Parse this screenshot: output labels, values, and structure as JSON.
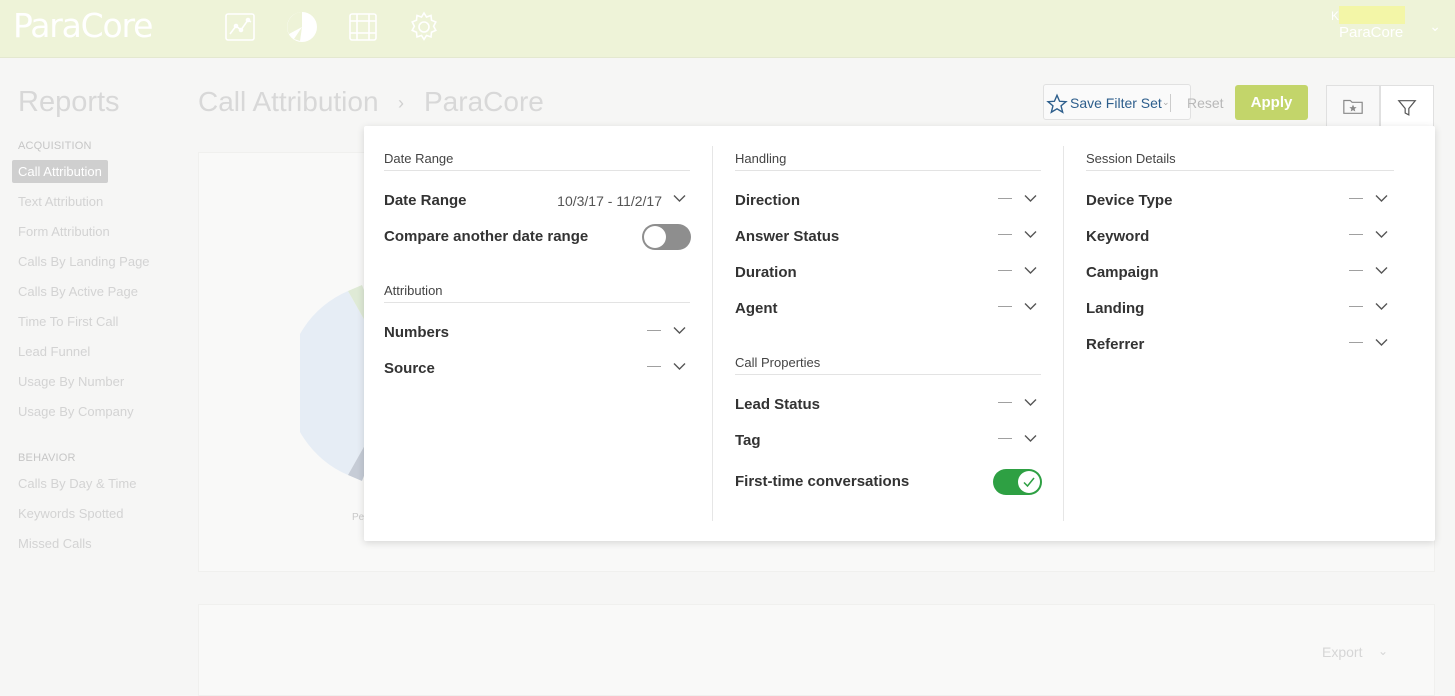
{
  "app": {
    "logo": "ParaCore",
    "nav_icons": [
      "analytics-icon",
      "pie-chart-icon",
      "integrations-icon",
      "settings-icon"
    ],
    "user": {
      "initial": "K",
      "account": "ParaCore"
    }
  },
  "sidebar": {
    "title": "Reports",
    "sections": [
      {
        "heading": "ACQUISITION",
        "items": [
          "Call Attribution",
          "Text Attribution",
          "Form Attribution",
          "Calls By Landing Page",
          "Calls By Active Page",
          "Time To First Call",
          "Lead Funnel",
          "Usage By Number",
          "Usage By Company"
        ]
      },
      {
        "heading": "BEHAVIOR",
        "items": [
          "Calls By Day & Time",
          "Keywords Spotted",
          "Missed Calls"
        ]
      }
    ],
    "active_item": "Call Attribution"
  },
  "header": {
    "breadcrumb": [
      "Call Attribution",
      "ParaCore"
    ],
    "save_filter_label": "Save Filter Set",
    "reset_label": "Reset",
    "apply_label": "Apply"
  },
  "background": {
    "chart_label_fragment": "Pe",
    "export_label": "Export"
  },
  "filters": {
    "date_range": {
      "title": "Date Range",
      "date_label": "Date Range",
      "date_value": "10/3/17 - 11/2/17",
      "compare_label": "Compare another date range",
      "compare_enabled": false
    },
    "attribution": {
      "title": "Attribution",
      "rows": [
        {
          "label": "Numbers",
          "value": "—"
        },
        {
          "label": "Source",
          "value": "—"
        }
      ]
    },
    "handling": {
      "title": "Handling",
      "rows": [
        {
          "label": "Direction",
          "value": "—"
        },
        {
          "label": "Answer Status",
          "value": "—"
        },
        {
          "label": "Duration",
          "value": "—"
        },
        {
          "label": "Agent",
          "value": "—"
        }
      ]
    },
    "call_properties": {
      "title": "Call Properties",
      "rows": [
        {
          "label": "Lead Status",
          "value": "—"
        },
        {
          "label": "Tag",
          "value": "—"
        }
      ],
      "first_time_label": "First-time conversations",
      "first_time_enabled": true
    },
    "session_details": {
      "title": "Session Details",
      "rows": [
        {
          "label": "Device Type",
          "value": "—"
        },
        {
          "label": "Keyword",
          "value": "—"
        },
        {
          "label": "Campaign",
          "value": "—"
        },
        {
          "label": "Landing",
          "value": "—"
        },
        {
          "label": "Referrer",
          "value": "—"
        }
      ]
    }
  },
  "colors": {
    "topbar": "#eef3d8",
    "apply": "#c3d56a",
    "link": "#2d5e8c",
    "toggle_on": "#2ea043",
    "toggle_off": "#8e8e8e"
  }
}
